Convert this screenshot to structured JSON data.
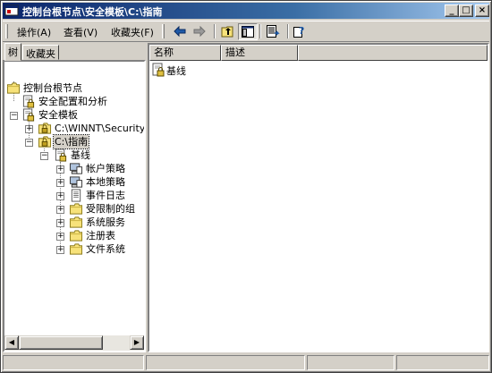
{
  "window": {
    "title": "控制台根节点\\安全模板\\C:\\指南",
    "minimize": "_",
    "maximize": "□",
    "close": "×"
  },
  "menu": {
    "action": "操作(A)",
    "view": "查看(V)",
    "favorites": "收藏夹(F)"
  },
  "toolbar": {
    "icons": [
      "back-icon",
      "forward-icon",
      "up-folder-icon",
      "show-hide-tree-icon",
      "export-list-icon",
      "help-icon"
    ]
  },
  "left_tabs": {
    "tree": "树",
    "favorites": "收藏夹"
  },
  "tree": {
    "root": "控制台根节点",
    "security_config": "安全配置和分析",
    "templates": "安全模板",
    "winnt_path": "C:\\WINNT\\Security\\Te",
    "guide": "C:\\指南",
    "baseline": "基线",
    "account_policy": "帐户策略",
    "local_policy": "本地策略",
    "event_log": "事件日志",
    "restricted_groups": "受限制的组",
    "system_services": "系统服务",
    "registry": "注册表",
    "file_system": "文件系统"
  },
  "list": {
    "columns": [
      "名称",
      "描述"
    ],
    "rows": [
      {
        "name": "基线",
        "desc": ""
      }
    ]
  }
}
